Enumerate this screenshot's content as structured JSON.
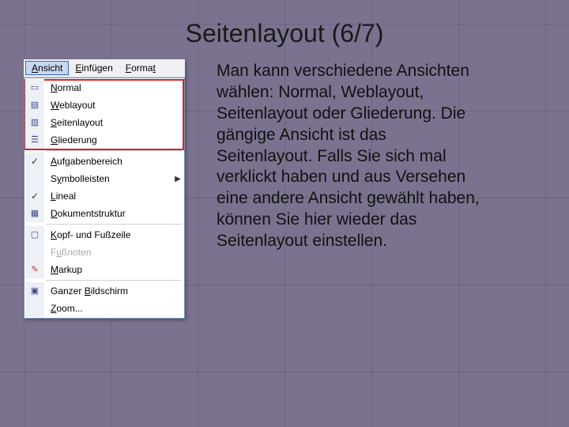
{
  "title": "Seitenlayout (6/7)",
  "menubar": {
    "ansicht": "Ansicht",
    "einfuegen": "Einfügen",
    "format": "Format"
  },
  "menu": {
    "normal": "Normal",
    "weblayout": "Weblayout",
    "seitenlayout": "Seitenlayout",
    "gliederung": "Gliederung",
    "aufgabenbereich": "Aufgabenbereich",
    "symbolleisten": "Symbolleisten",
    "lineal": "Lineal",
    "dokumentstruktur": "Dokumentstruktur",
    "kopf_fuss": "Kopf- und Fußzeile",
    "fussnoten": "Fußnoten",
    "markup": "Markup",
    "ganzer_bildschirm": "Ganzer Bildschirm",
    "zoom": "Zoom..."
  },
  "description": "Man kann verschiedene Ansichten wählen: Normal, Weblayout, Seitenlayout oder Gliederung. Die gängige Ansicht ist das Seitenlayout. Falls Sie sich mal verklickt haben und aus Versehen eine andere Ansicht gewählt haben, können Sie hier wieder das Seitenlayout einstellen."
}
